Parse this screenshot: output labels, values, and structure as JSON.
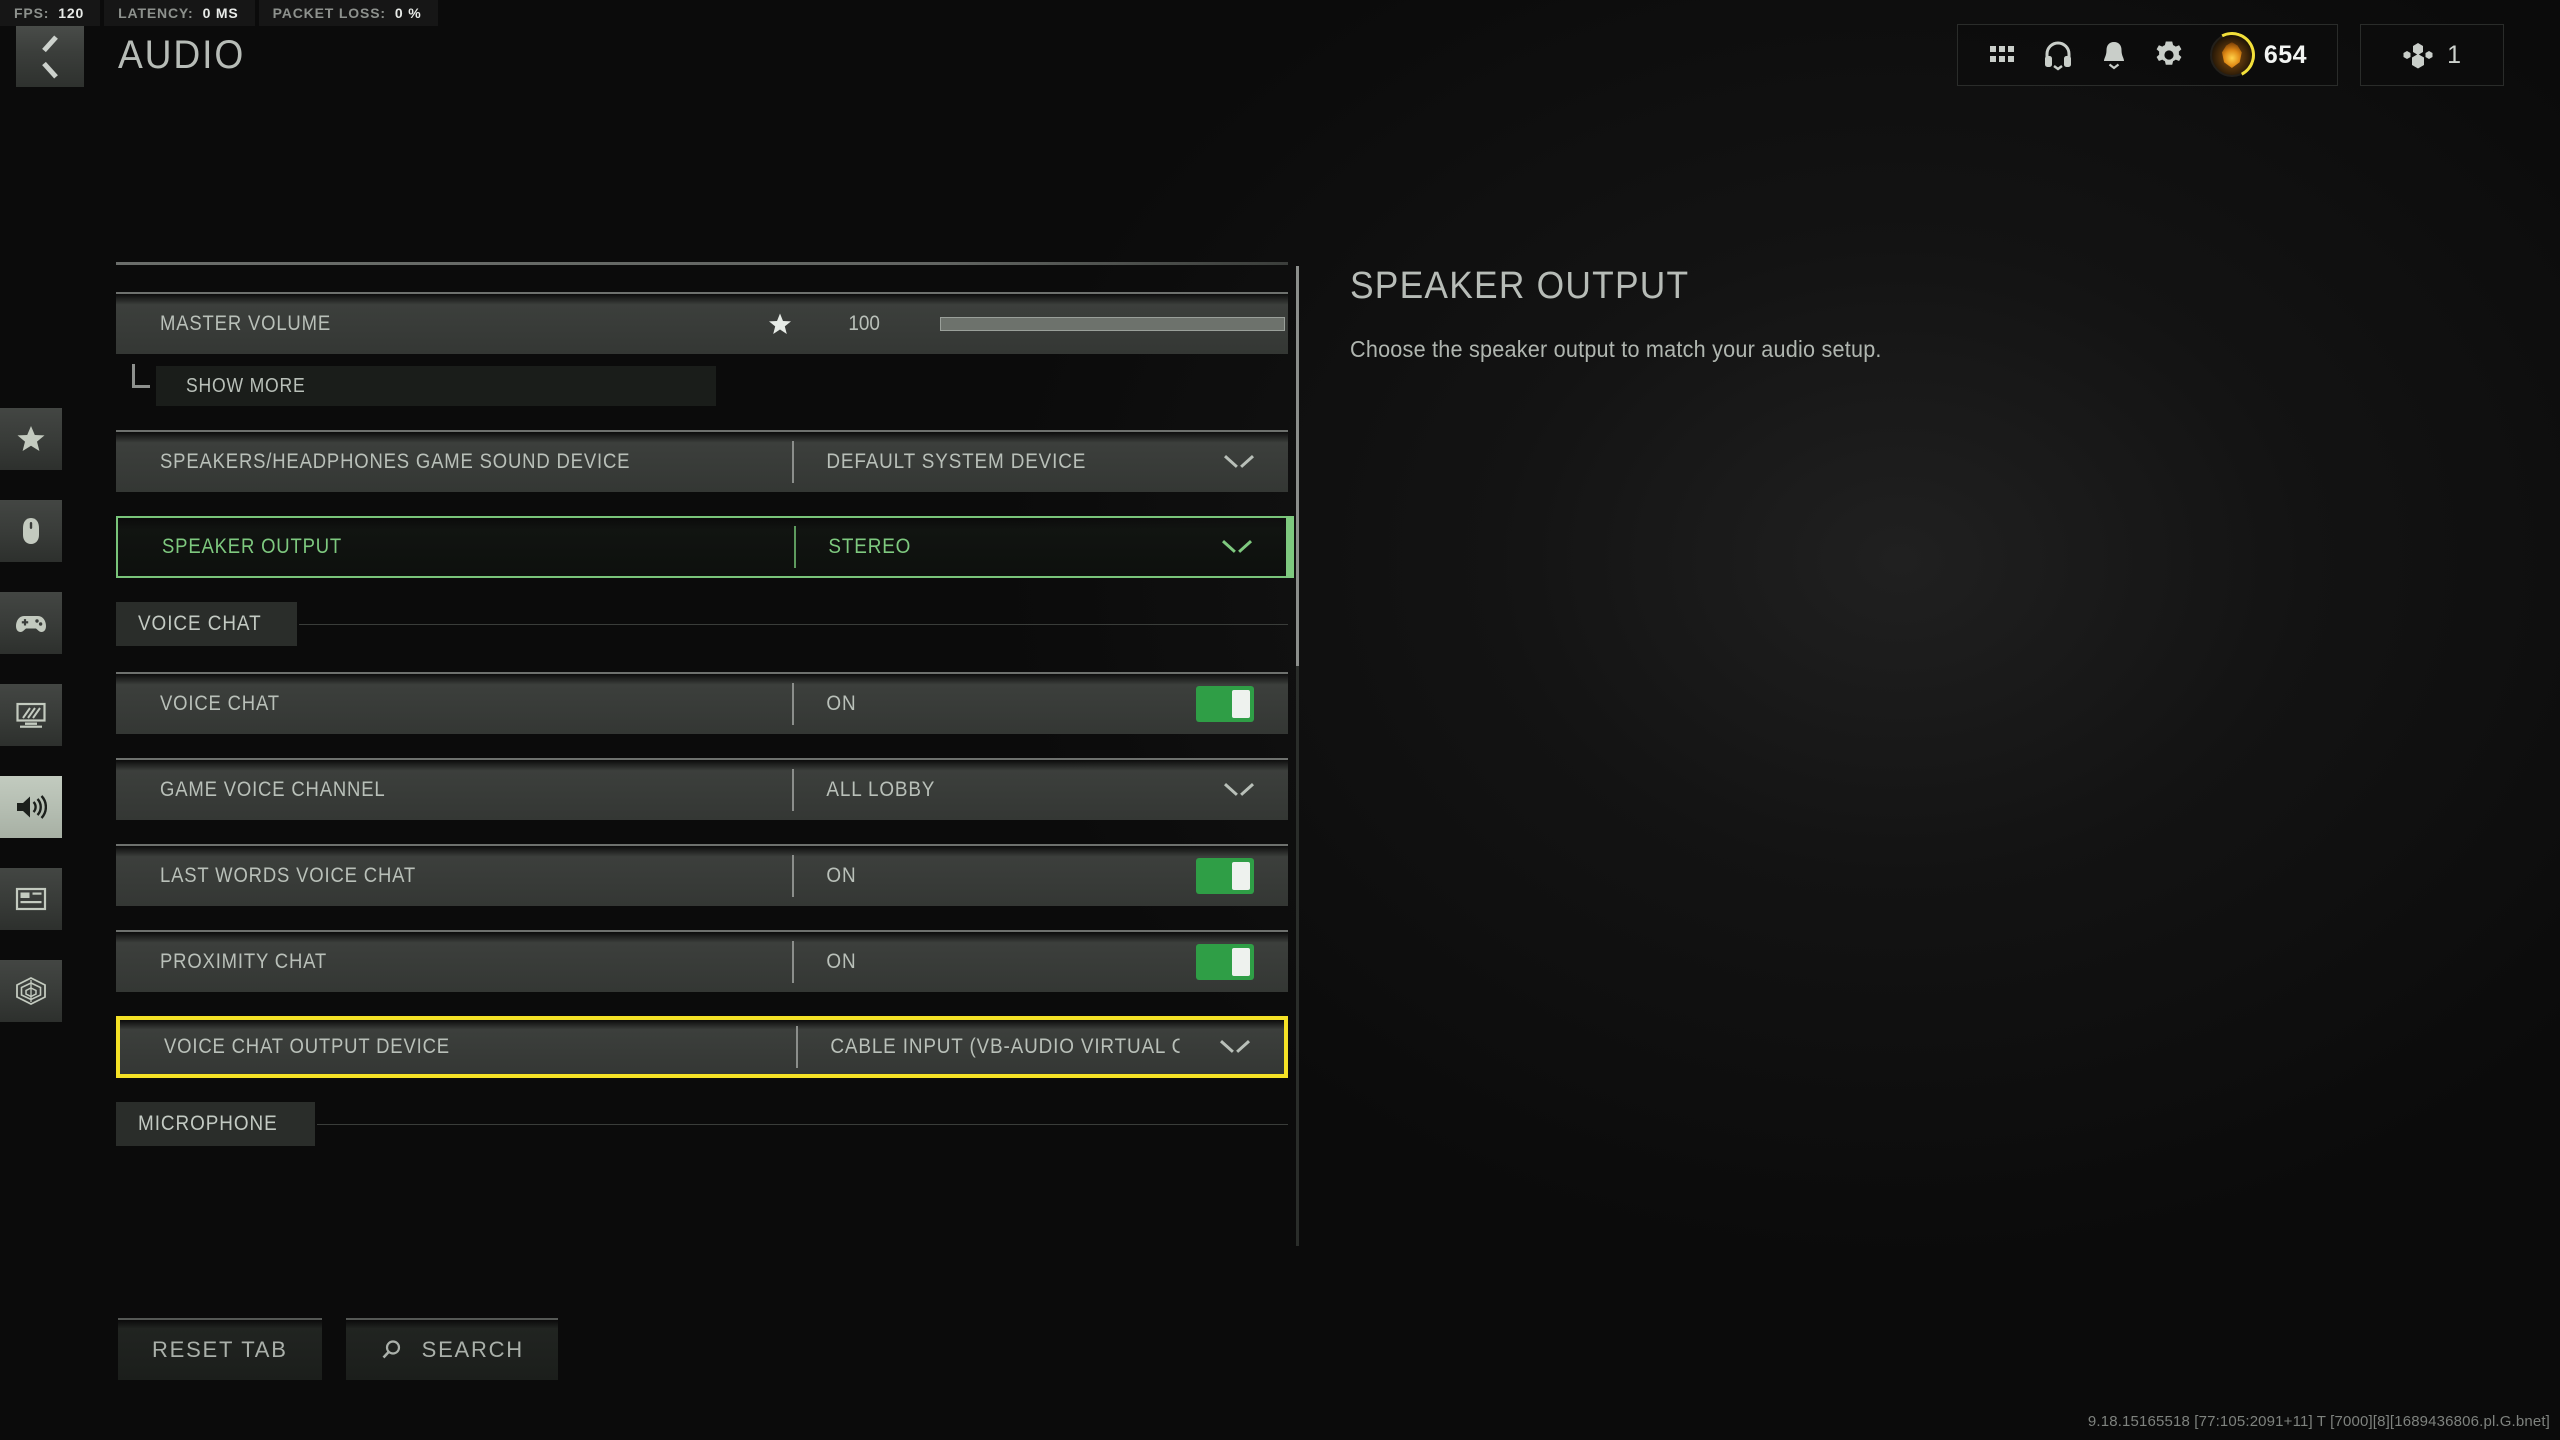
{
  "perf": [
    {
      "label": "FPS:",
      "value": "120"
    },
    {
      "label": "LATENCY:",
      "value": "0 MS"
    },
    {
      "label": "PACKET LOSS:",
      "value": "0 %"
    }
  ],
  "header": {
    "title": "AUDIO",
    "back_icon": "chevron-left-icon",
    "icons": [
      "grid-icon",
      "headphones-icon",
      "bell-icon",
      "gear-icon"
    ],
    "rank": {
      "value": "654",
      "emblem_color": "#e08a16",
      "ring_color": "#f3e03a"
    },
    "party": {
      "count": "1",
      "icon": "party-icon"
    }
  },
  "sidebar": {
    "items": [
      {
        "name": "favorites",
        "icon": "star-icon",
        "active": false
      },
      {
        "name": "mouse-keyboard",
        "icon": "mouse-icon",
        "active": false
      },
      {
        "name": "controller",
        "icon": "gamepad-icon",
        "active": false
      },
      {
        "name": "graphics",
        "icon": "monitor-icon",
        "active": false
      },
      {
        "name": "audio",
        "icon": "speaker-icon",
        "active": true
      },
      {
        "name": "interface",
        "icon": "hud-layout-icon",
        "active": false
      },
      {
        "name": "accessibility",
        "icon": "radar-icon",
        "active": false
      }
    ]
  },
  "settings": {
    "rows": [
      {
        "kind": "slider",
        "label": "MASTER VOLUME",
        "starred": true,
        "value": "100",
        "fill_percent": 100
      },
      {
        "kind": "submore",
        "label": "SHOW MORE"
      },
      {
        "kind": "dropdown",
        "label": "SPEAKERS/HEADPHONES GAME SOUND DEVICE",
        "value": "DEFAULT SYSTEM DEVICE",
        "state": "normal"
      },
      {
        "kind": "dropdown",
        "label": "SPEAKER OUTPUT",
        "value": "STEREO",
        "state": "selected-green"
      },
      {
        "kind": "section",
        "label": "VOICE CHAT"
      },
      {
        "kind": "toggle",
        "label": "VOICE CHAT",
        "value": "ON",
        "on": true
      },
      {
        "kind": "dropdown",
        "label": "GAME VOICE CHANNEL",
        "value": "ALL LOBBY",
        "state": "normal"
      },
      {
        "kind": "toggle",
        "label": "LAST WORDS VOICE CHAT",
        "value": "ON",
        "on": true
      },
      {
        "kind": "toggle",
        "label": "PROXIMITY CHAT",
        "value": "ON",
        "on": true
      },
      {
        "kind": "dropdown",
        "label": "VOICE CHAT OUTPUT DEVICE",
        "value": "CABLE INPUT (VB-AUDIO VIRTUAL CABI",
        "state": "selected-yellow"
      },
      {
        "kind": "section",
        "label": "MICROPHONE"
      }
    ]
  },
  "detail": {
    "title": "SPEAKER OUTPUT",
    "description": "Choose the speaker output to match your audio setup."
  },
  "bottom": {
    "reset_label": "RESET TAB",
    "search_label": "SEARCH",
    "search_icon": "search-icon"
  },
  "version": "9.18.15165518 [77:105:2091+11] T [7000][8][1689436806.pl.G.bnet]",
  "colors": {
    "accent_green": "#7ec97f",
    "accent_yellow": "#f5e226",
    "toggle_on": "#2f9e46",
    "text": "#b9c0b9"
  }
}
